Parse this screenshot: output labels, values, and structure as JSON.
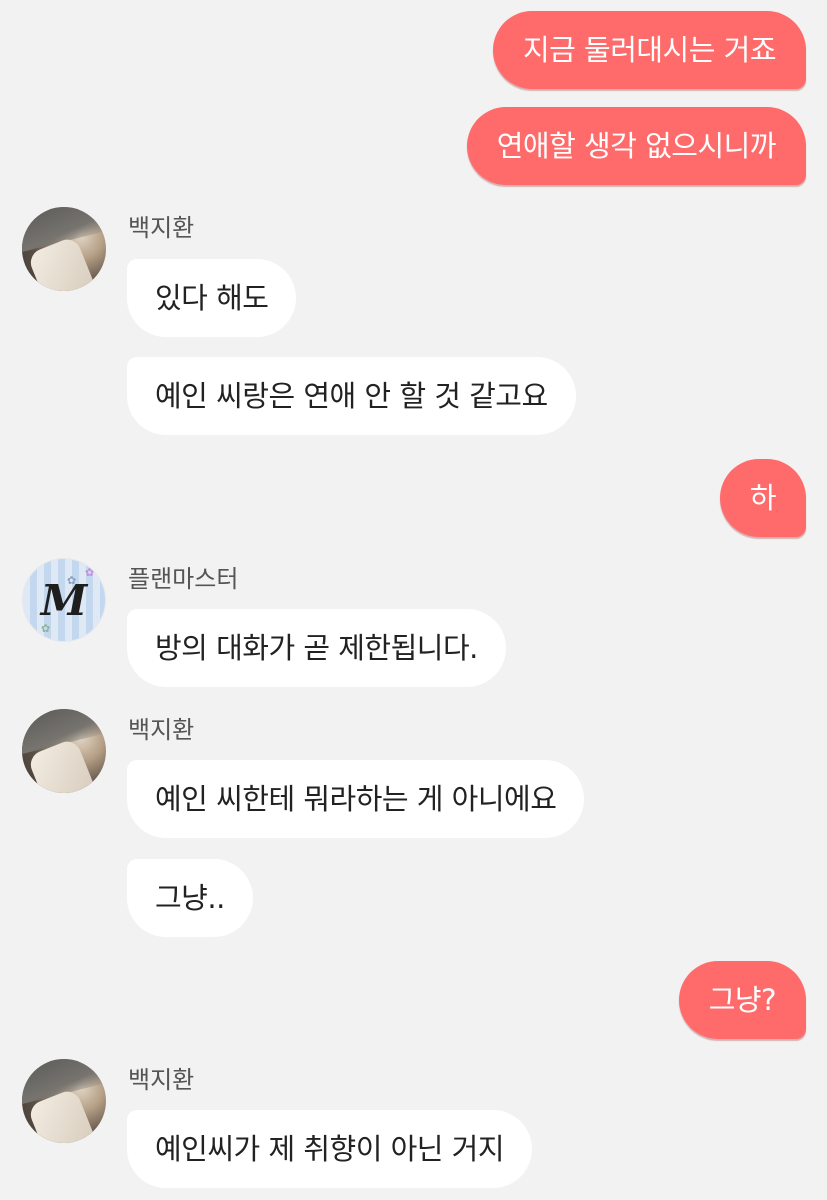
{
  "messages": [
    {
      "type": "me",
      "text": "지금 둘러대시는 거죠"
    },
    {
      "type": "me",
      "text": "연애할 생각 없으시니까"
    },
    {
      "type": "them_header",
      "sender": "백지환",
      "avatar": "person-photo"
    },
    {
      "type": "them",
      "text": "있다 해도"
    },
    {
      "type": "them",
      "text": "예인 씨랑은 연애 안 할 것 같고요"
    },
    {
      "type": "me",
      "text": "하"
    },
    {
      "type": "them_header",
      "sender": "플랜마스터",
      "avatar": "monogram-M",
      "avatar_text": "M"
    },
    {
      "type": "them",
      "text": "방의 대화가 곧 제한됩니다."
    },
    {
      "type": "them_header",
      "sender": "백지환",
      "avatar": "person-photo"
    },
    {
      "type": "them",
      "text": "예인 씨한테 뭐라하는 게 아니에요"
    },
    {
      "type": "them",
      "text": "그냥.."
    },
    {
      "type": "me",
      "text": "그냥?"
    },
    {
      "type": "them_header",
      "sender": "백지환",
      "avatar": "person-photo"
    },
    {
      "type": "them",
      "text": "예인씨가 제 취향이 아닌 거지"
    }
  ],
  "colors": {
    "background": "#f2f2f2",
    "my_bubble": "#ff6b6b",
    "their_bubble": "#ffffff"
  }
}
